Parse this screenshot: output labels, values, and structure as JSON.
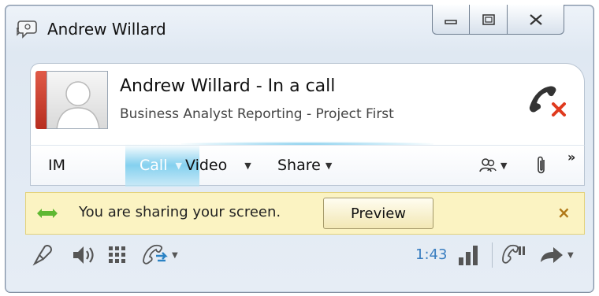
{
  "window": {
    "title": "Andrew Willard"
  },
  "contact": {
    "name_status": "Andrew Willard - In a call",
    "subtitle": "Business Analyst Reporting - Project First"
  },
  "toolbar": {
    "im_label": "IM",
    "call_label": "Call",
    "video_label": "Video",
    "share_label": "Share",
    "more_glyph": "»"
  },
  "banner": {
    "message": "You are sharing your screen.",
    "preview_label": "Preview",
    "close_glyph": "×"
  },
  "call_controls": {
    "timer": "1:43"
  },
  "colors": {
    "presence_busy": "#c9392b",
    "call_highlight": "#7ecfee",
    "banner_bg": "#fbf3c2",
    "timer_text": "#3a7ec0",
    "hangup_red": "#e03a1e"
  }
}
